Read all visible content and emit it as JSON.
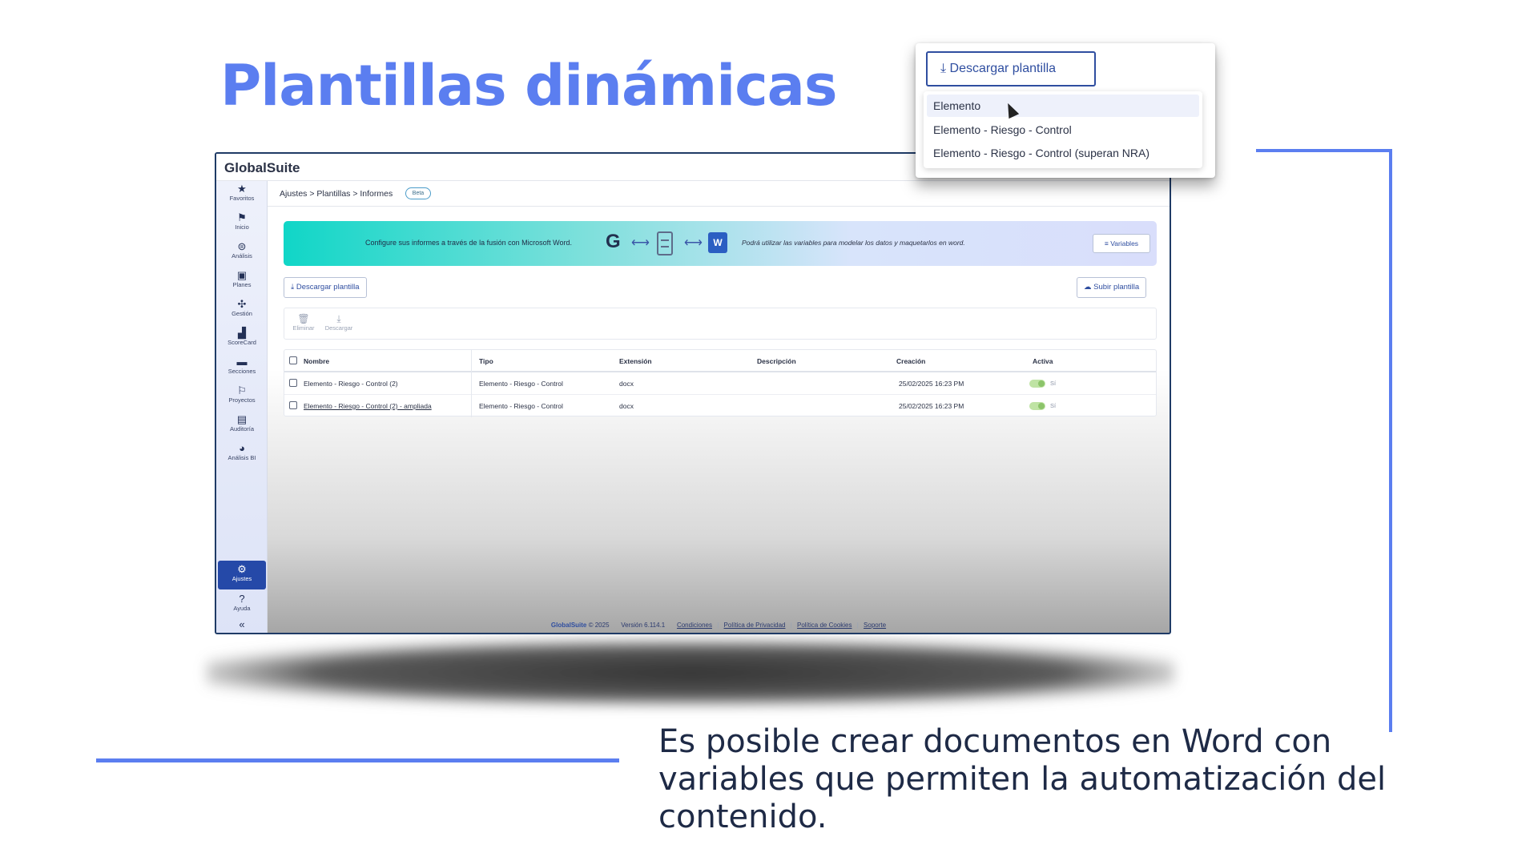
{
  "slide": {
    "title": "Plantillas dinámicas",
    "caption": "Es posible crear documentos en Word con variables que permiten la automatización del contenido.",
    "accent_color": "#5b7ef0"
  },
  "app": {
    "logo": "GlobalSuite",
    "breadcrumb": "Ajustes > Plantillas > Informes",
    "badge": "Beta",
    "sidebar": {
      "items": [
        {
          "icon": "star-icon",
          "glyph": "★",
          "label": "Favoritos"
        },
        {
          "icon": "flag-icon",
          "glyph": "⚑",
          "label": "Inicio"
        },
        {
          "icon": "analysis-icon",
          "glyph": "⊜",
          "label": "Análisis"
        },
        {
          "icon": "plans-icon",
          "glyph": "▣",
          "label": "Planes"
        },
        {
          "icon": "management-icon",
          "glyph": "✣",
          "label": "Gestión"
        },
        {
          "icon": "scorecard-icon",
          "glyph": "▟",
          "label": "ScoreCard"
        },
        {
          "icon": "folder-icon",
          "glyph": "▬",
          "label": "Secciones"
        },
        {
          "icon": "projects-icon",
          "glyph": "⚐",
          "label": "Proyectos"
        },
        {
          "icon": "audit-icon",
          "glyph": "▤",
          "label": "Auditoría"
        },
        {
          "icon": "pie-chart-icon",
          "glyph": "◕",
          "label": "Análisis BI"
        }
      ],
      "settings": {
        "icon": "gear-icon",
        "glyph": "⚙",
        "label": "Ajustes"
      },
      "help": {
        "icon": "help-icon",
        "glyph": "?",
        "label": "Ayuda"
      },
      "collapse_glyph": "«"
    },
    "banner": {
      "text": "Configure sus informes a través de la fusión con Microsoft Word.",
      "note": "Podrá utilizar las variables para modelar los datos y maquetarlos en word.",
      "variables_button": "≡ Variables",
      "google_glyph": "G",
      "arrow_glyph": "⟷",
      "word_glyph": "W"
    },
    "download_button": "⤓ Descargar plantilla",
    "upload_button": "☁ Subir plantilla",
    "toolbar": {
      "delete": {
        "glyph": "🗑",
        "label": "Eliminar"
      },
      "download": {
        "glyph": "⤓",
        "label": "Descargar"
      }
    },
    "table": {
      "columns": [
        "Nombre",
        "Tipo",
        "Extensión",
        "Descripción",
        "Creación",
        "Activa"
      ],
      "rows": [
        {
          "name": "Elemento - Riesgo - Control (2)",
          "type": "Elemento - Riesgo - Control",
          "ext": "docx",
          "desc": "",
          "created": "25/02/2025 16:23 PM",
          "active": "Sí"
        },
        {
          "name": "Elemento - Riesgo - Control (2) - ampliada",
          "type": "Elemento - Riesgo - Control",
          "ext": "docx",
          "desc": "",
          "created": "25/02/2025 16:23 PM",
          "active": "Sí"
        }
      ]
    },
    "footer": {
      "brand": "GlobalSuite",
      "copyright": "© 2025",
      "version": "Versión 6.114.1",
      "links": [
        "Condiciones",
        "Política de Privacidad",
        "Política de Cookies",
        "Soporte"
      ]
    }
  },
  "dropdown": {
    "button": "⤓ Descargar plantilla",
    "items": [
      "Elemento",
      "Elemento - Riesgo - Control",
      "Elemento - Riesgo - Control (superan NRA)"
    ]
  }
}
